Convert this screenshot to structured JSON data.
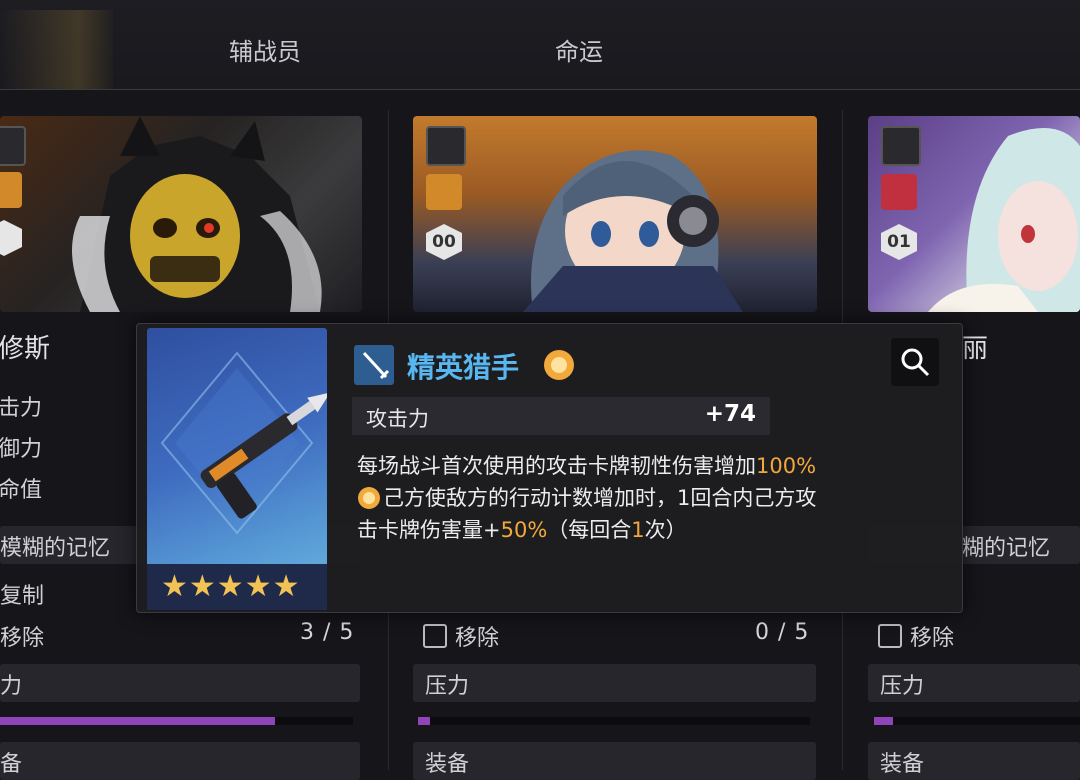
{
  "tabs": [
    {
      "label": "辅战员"
    },
    {
      "label": "命运"
    }
  ],
  "columns": [
    {
      "name": "修斯",
      "stats": [
        "击力",
        "御力",
        "命值"
      ],
      "memory": "模糊的记忆",
      "copy_label": "复制",
      "remove_label": "移除",
      "remove_count": "3 / 5",
      "stress_label": "力",
      "stress_level": 0.78,
      "equip_label": "备",
      "badge_level": ""
    },
    {
      "name": "",
      "stats": [],
      "memory": "",
      "copy_label": "",
      "remove_label": "移除",
      "remove_count": "0 / 5",
      "stress_label": "压力",
      "stress_level": 0.03,
      "equip_label": "装备",
      "badge_level": "00"
    },
    {
      "name": "丽",
      "stats": [],
      "memory": "糊的记忆",
      "copy_label": "",
      "remove_label": "移除",
      "remove_count": "",
      "stress_label": "压力",
      "stress_level": 0.09,
      "equip_label": "装备",
      "badge_level": "01"
    }
  ],
  "tooltip": {
    "title": "精英猎手",
    "stat_label": "攻击力",
    "stat_value": "+74",
    "desc_line1_a": "每场战斗首次使用的攻击卡牌韧性伤害增加",
    "desc_line1_b": "100%",
    "desc_line2": "己方使敌方的行动计数增加时，1回合内己方攻",
    "desc_line3_a": "击卡牌伤害量+",
    "desc_line3_b": "50%",
    "desc_line3_c": "（每回合",
    "desc_line3_d": "1",
    "desc_line3_e": "次）",
    "stars": "★★★★★",
    "rarity": 5
  },
  "colors": {
    "accent_blue": "#58b6f0",
    "highlight_orange": "#f2a83b",
    "stress_purple": "#8f45b8",
    "star_gold": "#f2c254"
  }
}
